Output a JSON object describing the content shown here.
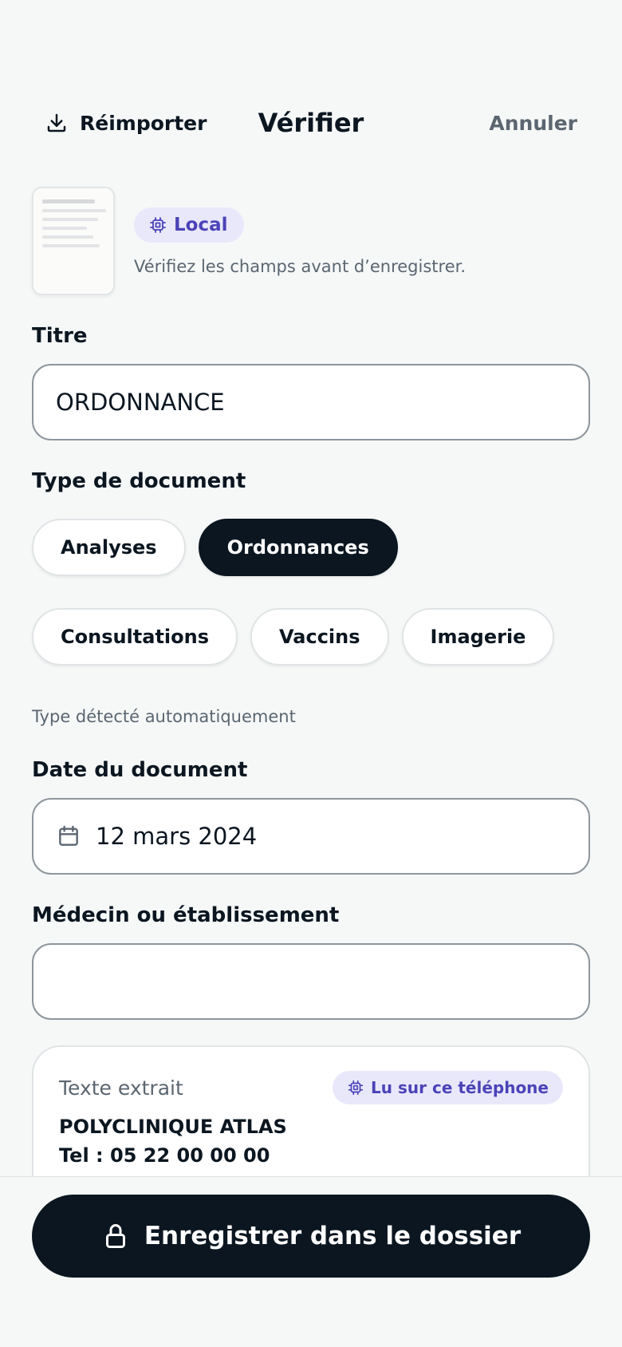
{
  "header": {
    "reimport_label": "Réimporter",
    "title": "Vérifier",
    "cancel_label": "Annuler"
  },
  "document": {
    "badge_label": "Local",
    "hint": "Vérifiez les champs avant d’enregistrer."
  },
  "title_field": {
    "label": "Titre",
    "value": "ORDONNANCE"
  },
  "doc_type": {
    "label": "Type de document",
    "options": [
      "Analyses",
      "Ordonnances",
      "Consultations",
      "Vaccins",
      "Imagerie"
    ],
    "selected": "Ordonnances",
    "hint": "Type détecté automatiquement"
  },
  "date_field": {
    "label": "Date du document",
    "value": "12 mars 2024"
  },
  "doctor_field": {
    "label": "Médecin ou établissement",
    "value": ""
  },
  "extracted": {
    "title": "Texte extrait",
    "badge_label": "Lu sur ce téléphone",
    "lines": [
      "POLYCLINIQUE ATLAS",
      "Tel : 05 22 00 00 00"
    ]
  },
  "save_button": {
    "label": "Enregistrer dans le dossier"
  },
  "colors": {
    "primary_dark": "#0b1620",
    "accent_purple": "#4b43b8",
    "badge_bg": "#e9e8fb",
    "muted_text": "#5b6670",
    "background": "#f6f8f8"
  },
  "icons": {
    "reimport": "download-icon",
    "local_badge": "chip-icon",
    "date": "calendar-icon",
    "save": "lock-icon"
  }
}
